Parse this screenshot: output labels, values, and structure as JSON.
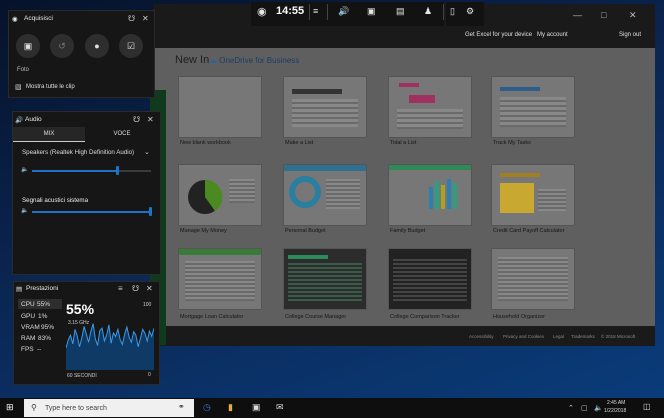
{
  "excel": {
    "new_in": "New In",
    "onedrive_label": "OneDrive for Business",
    "get_excel": "Get Excel for your device",
    "my_account": "My account",
    "sign_out": "Sign out",
    "templates": [
      {
        "label": "New blank workbook"
      },
      {
        "label": "Make a List"
      },
      {
        "label": "Total a List"
      },
      {
        "label": "Track My Tasks"
      },
      {
        "label": "Manage My Money"
      },
      {
        "label": "Personal Budget"
      },
      {
        "label": "Family Budget"
      },
      {
        "label": "Credit Card Payoff Calculator"
      },
      {
        "label": "Mortgage Loan Calculator"
      },
      {
        "label": "College Course Manager"
      },
      {
        "label": "College Comparison Tracker"
      },
      {
        "label": "Household Organizer"
      }
    ],
    "footer_links": [
      "Accessibility",
      "Privacy and Cookies",
      "Legal",
      "Trademarks",
      "© 2018 Microsoft"
    ]
  },
  "gamebar": {
    "time": "14:55"
  },
  "capture": {
    "title": "Acquisisci",
    "foto_label": "Foto",
    "show_all_clips": "Mostra tutte le clip"
  },
  "audio": {
    "title": "Audio",
    "tab_mix": "MIX",
    "tab_voice": "VOCE",
    "device": "Speakers (Realtek High Definition Audio)",
    "system_sounds": "Segnali acustici sistema",
    "speaker_level": 0.72,
    "system_level": 1.0
  },
  "performance": {
    "title": "Prestazioni",
    "stats": [
      {
        "label": "CPU",
        "value": "55%"
      },
      {
        "label": "GPU",
        "value": "1%"
      },
      {
        "label": "VRAM",
        "value": "95%"
      },
      {
        "label": "RAM",
        "value": "83%"
      },
      {
        "label": "FPS",
        "value": "--"
      }
    ],
    "big_value": "55%",
    "freq": "3.15 GHz",
    "max_label": "100",
    "min_label": "0",
    "duration": "60 SECONDI",
    "history": [
      38,
      52,
      60,
      45,
      70,
      58,
      40,
      55,
      75,
      62,
      48,
      66,
      80,
      54,
      42,
      68,
      72,
      50,
      60,
      78,
      46,
      64,
      58,
      70,
      52,
      44,
      62,
      74,
      56,
      48,
      66,
      60,
      40,
      55,
      70,
      63,
      50,
      67,
      58,
      72
    ]
  },
  "taskbar": {
    "search_placeholder": "Type here to search",
    "time": "2:45 AM",
    "date": "1/22/2018"
  }
}
